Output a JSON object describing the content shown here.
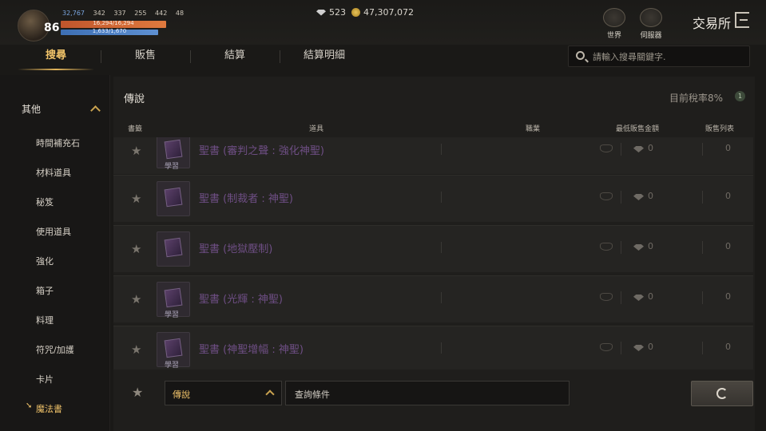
{
  "player": {
    "level": "86",
    "stat1": "32,767",
    "stat2": "342",
    "stat3": "337",
    "stat4": "255",
    "stat5": "442",
    "stat6": "48",
    "hp": "16,294/16,294",
    "mp": "1,633/1,670"
  },
  "currency": {
    "gems": "523",
    "gold": "47,307,072"
  },
  "top_icons": {
    "world_label": "世界",
    "server_label": "伺服器"
  },
  "window_title": "交易所",
  "tabs": [
    {
      "label": "搜尋",
      "active": true
    },
    {
      "label": "販售",
      "active": false
    },
    {
      "label": "結算",
      "active": false
    },
    {
      "label": "結算明細",
      "active": false
    }
  ],
  "search": {
    "placeholder": "請輸入搜尋關鍵字."
  },
  "sidebar": {
    "category": "其他",
    "items": [
      {
        "label": "時間補充石"
      },
      {
        "label": "材料道具"
      },
      {
        "label": "秘笈"
      },
      {
        "label": "使用道具"
      },
      {
        "label": "強化"
      },
      {
        "label": "箱子"
      },
      {
        "label": "料理"
      },
      {
        "label": "符咒/加護"
      },
      {
        "label": "卡片"
      },
      {
        "label": "魔法書",
        "active": true
      }
    ]
  },
  "panel": {
    "title": "傳說",
    "tax": "目前稅率8%",
    "tax_icon": "1"
  },
  "table": {
    "headers": {
      "bookmark": "書籤",
      "item": "道具",
      "job": "職業",
      "min_price": "最低販售金額",
      "sale_list": "販售列表"
    },
    "rows": [
      {
        "name": "聖書 (審判之聲 : 強化神聖)",
        "tag": "學習",
        "price": "0",
        "count": "0"
      },
      {
        "name": "聖書 (制裁者 : 神聖)",
        "tag": "",
        "price": "0",
        "count": "0"
      },
      {
        "name": "聖書 (地獄壓制)",
        "tag": "",
        "price": "0",
        "count": "0"
      },
      {
        "name": "聖書 (光輝 : 神聖)",
        "tag": "學習",
        "price": "0",
        "count": "0"
      },
      {
        "name": "聖書 (神聖增幅 : 神聖)",
        "tag": "學習",
        "price": "0",
        "count": "0"
      }
    ]
  },
  "footer": {
    "grade": "傳說",
    "query_label": "查詢條件"
  }
}
